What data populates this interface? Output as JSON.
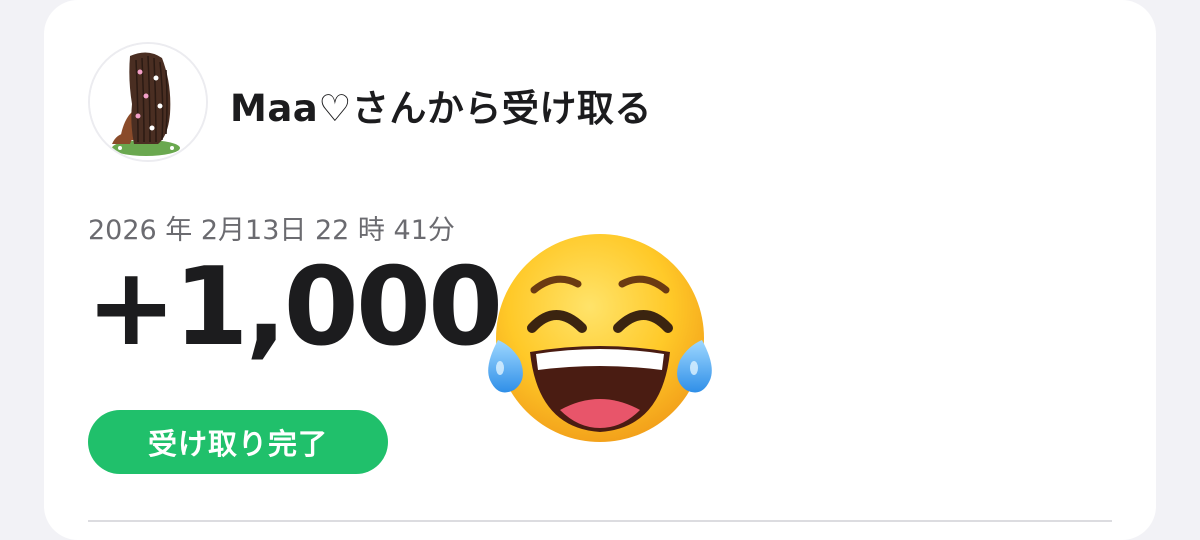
{
  "receipt": {
    "sender_title": "Maa♡さんから受け取る",
    "timestamp": "2026 年 2月13日 22 時 41分",
    "amount": "+1,000",
    "status": "受け取り完了"
  },
  "colors": {
    "background": "#f2f2f6",
    "card": "#ffffff",
    "status_green": "#20c06b",
    "text_primary": "#1c1c1e",
    "text_secondary": "#6b6b70"
  },
  "icons": {
    "avatar": "profile-avatar-illustration",
    "emoji": "face-with-tears-of-joy-emoji"
  }
}
